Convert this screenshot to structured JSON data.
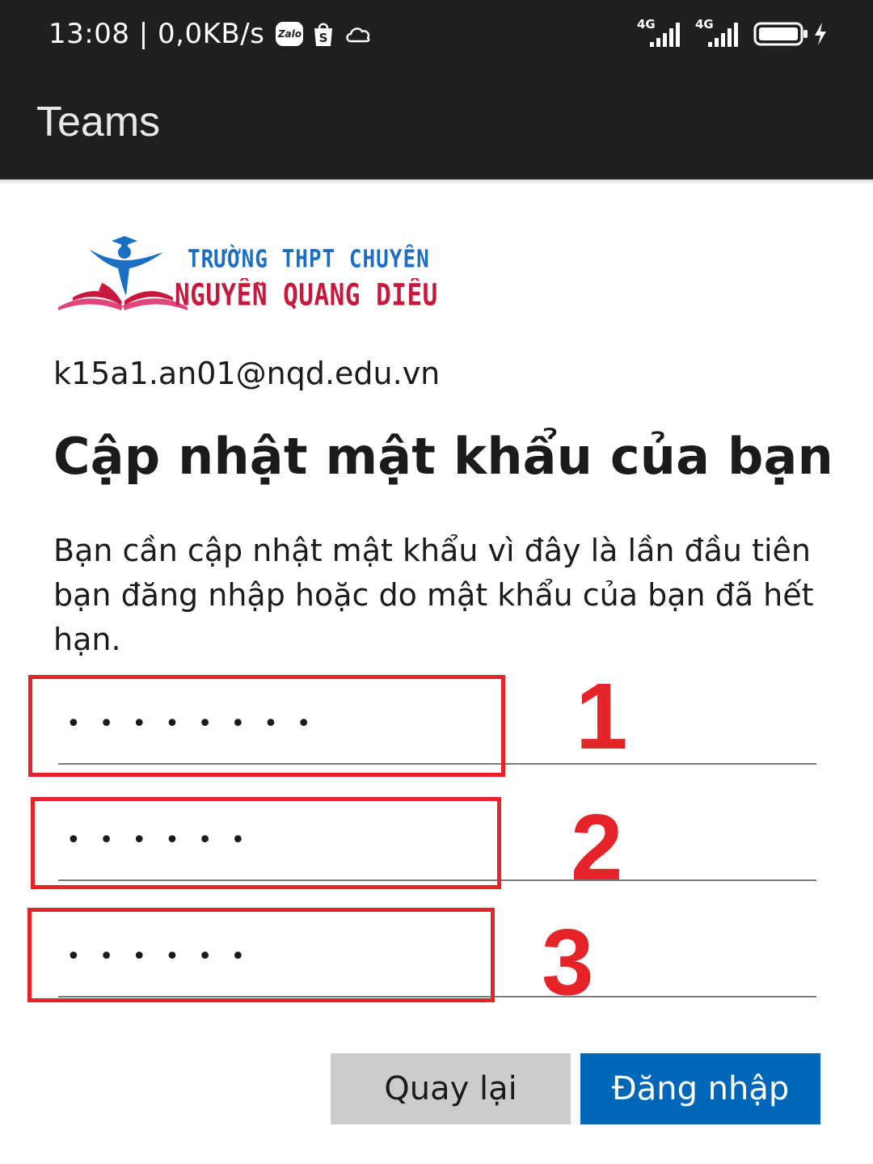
{
  "status_bar": {
    "time_speed": "13:08 | 0,0KB/s",
    "zalo_label": "Zalo",
    "sim1_network": "4G",
    "sim2_network": "4G"
  },
  "app_bar": {
    "title": "Teams"
  },
  "logo": {
    "line1": "TRƯỜNG THPT CHUYÊN",
    "line2": "NGUYỄN QUANG DIÊU",
    "colors": {
      "blue": "#1a6fc4",
      "red": "#c9183e"
    }
  },
  "form": {
    "email": "k15a1.an01@nqd.edu.vn",
    "heading": "Cập nhật mật khẩu của bạn",
    "description": "Bạn cần cập nhật mật khẩu vì đây là lần đầu tiên bạn đăng nhập hoặc do mật khẩu của bạn đã hết hạn.",
    "fields": [
      {
        "masked": "••••••••"
      },
      {
        "masked": "••••••"
      },
      {
        "masked": "••••••"
      }
    ],
    "back_label": "Quay lại",
    "signin_label": "Đăng nhập"
  },
  "annotations": {
    "labels": [
      "1",
      "2",
      "3"
    ],
    "color": "#e52329"
  },
  "colors": {
    "primary_button": "#0067b8",
    "secondary_button": "#cccccc",
    "header_bg": "#1f1f1f"
  }
}
